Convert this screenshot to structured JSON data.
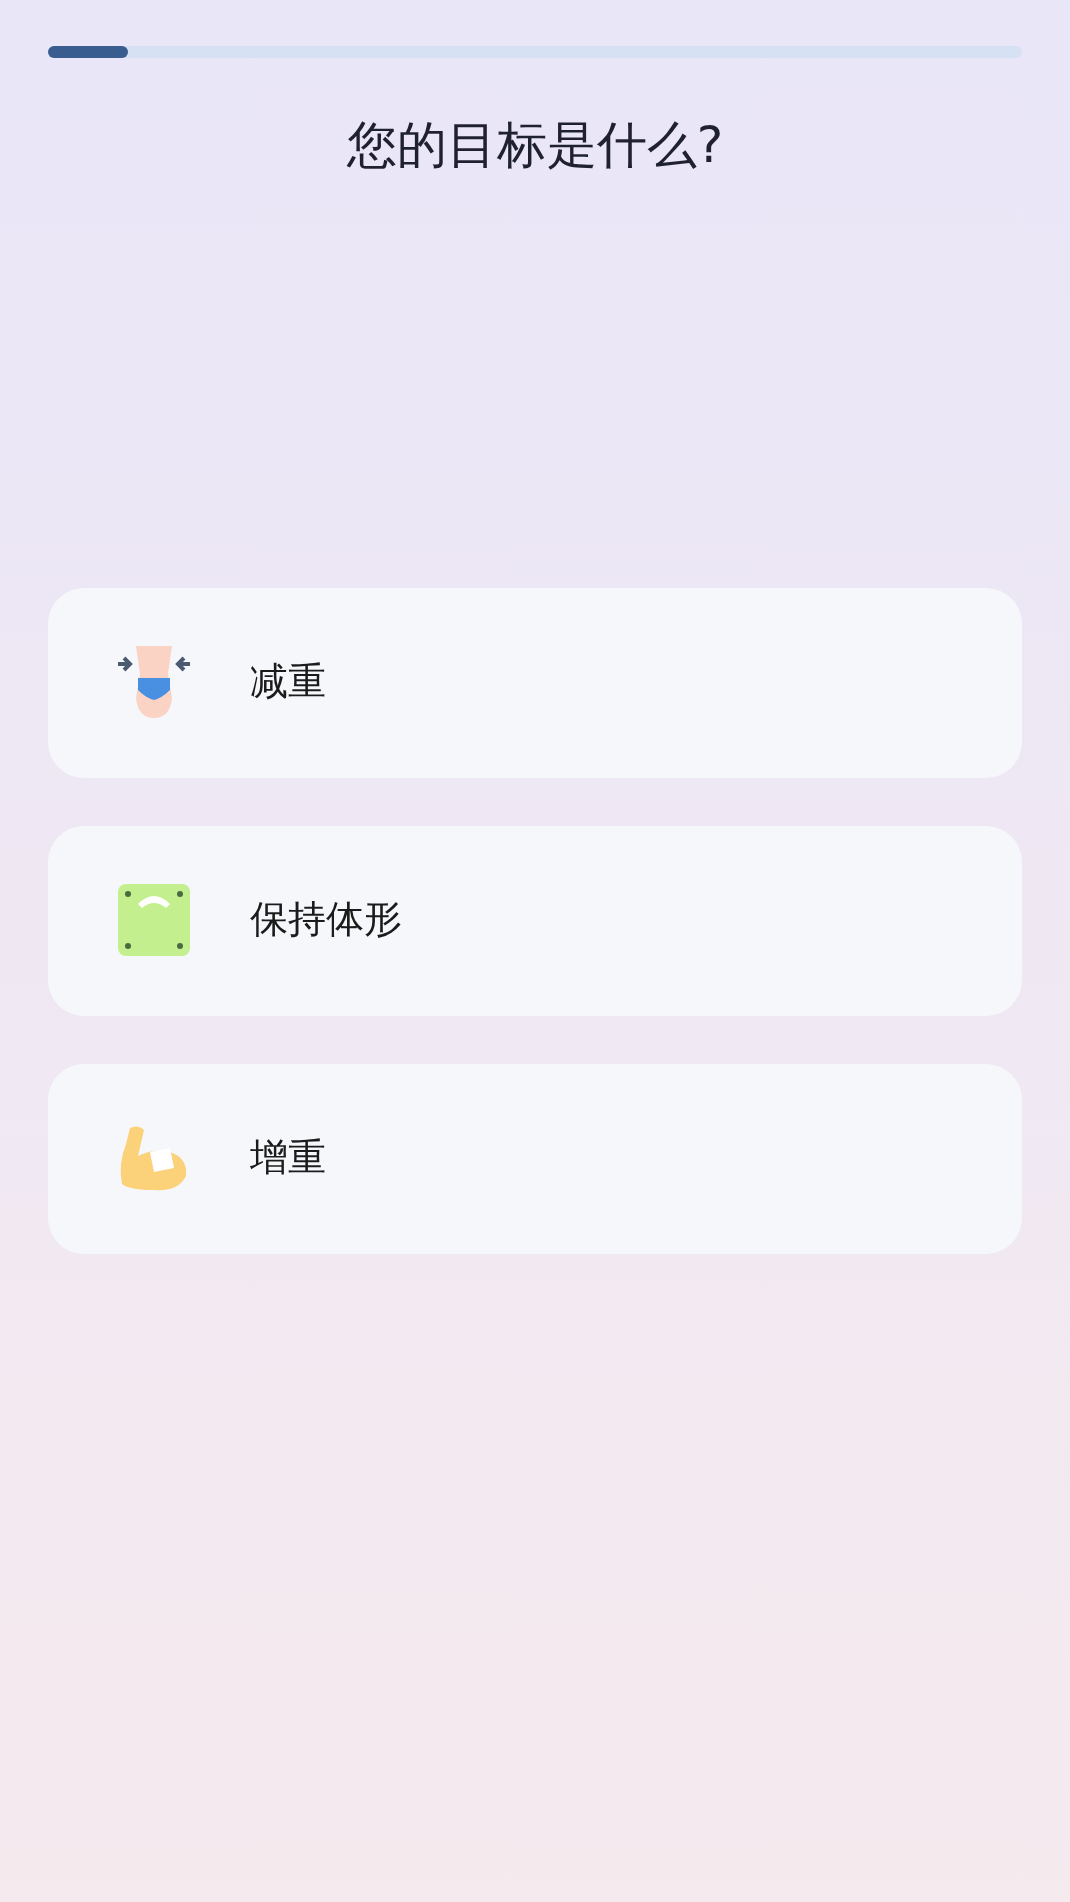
{
  "progress": {
    "level": 0.083
  },
  "title": "您的目标是什么?",
  "options": [
    {
      "kind": "waist",
      "label": "减重"
    },
    {
      "kind": "scale",
      "label": "保持体形"
    },
    {
      "kind": "muscle",
      "label": "增重"
    }
  ]
}
